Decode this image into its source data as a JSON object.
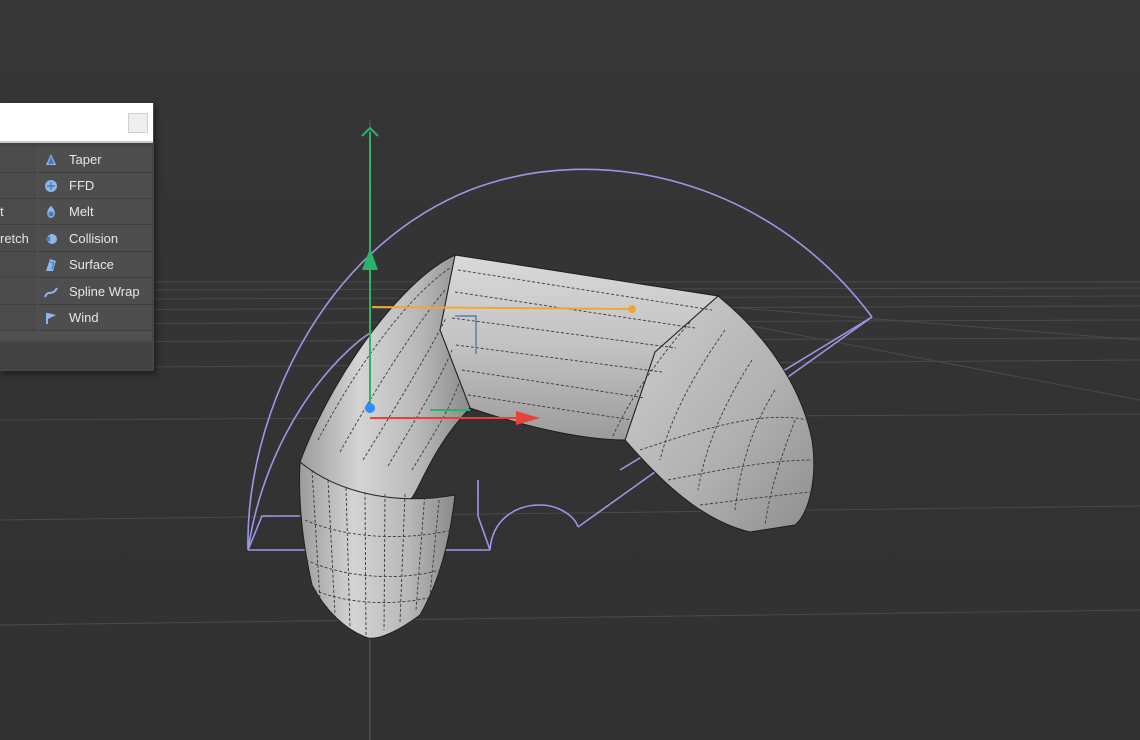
{
  "search": {
    "value": "",
    "placeholder": ""
  },
  "left_column": {
    "items": [
      "",
      "",
      "t",
      "retch",
      "",
      "",
      ""
    ]
  },
  "deformer_menu": {
    "items": [
      {
        "label": "Taper",
        "icon": "taper-deformer-icon"
      },
      {
        "label": "FFD",
        "icon": "ffd-deformer-icon"
      },
      {
        "label": "Melt",
        "icon": "melt-deformer-icon"
      },
      {
        "label": "Collision",
        "icon": "collision-deformer-icon"
      },
      {
        "label": "Surface",
        "icon": "surface-deformer-icon"
      },
      {
        "label": "Spline Wrap",
        "icon": "spline-wrap-deformer-icon"
      },
      {
        "label": "Wind",
        "icon": "wind-deformer-icon"
      }
    ]
  },
  "colors": {
    "viewport_bg": "#353535",
    "deformer_cage": "#9b97e6",
    "axis_y": "#2bb36a",
    "axis_x": "#e8413a",
    "axis_z": "#2f8bff",
    "handle": "#f3a531",
    "icon_blue": "#8db6ea"
  }
}
